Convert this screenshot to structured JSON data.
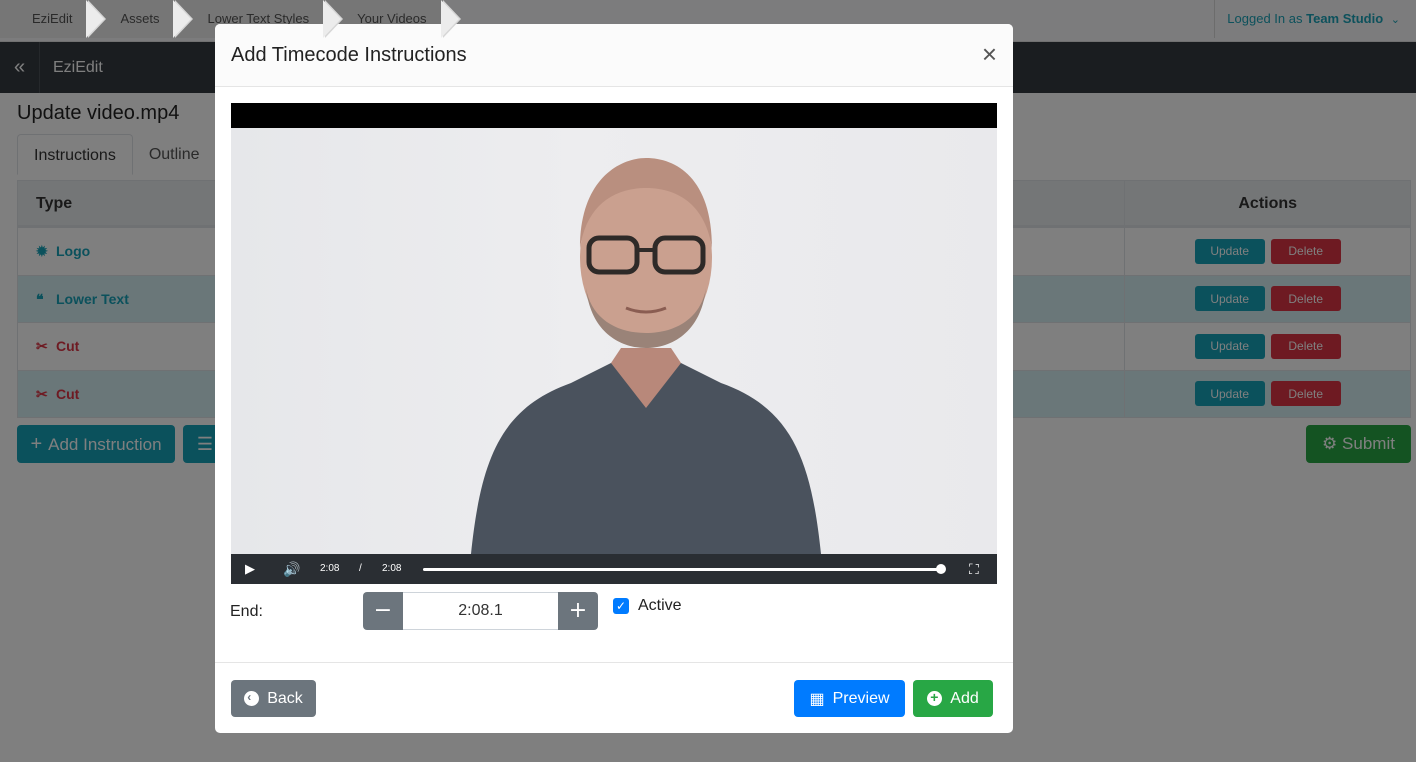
{
  "breadcrumbs": [
    "EziEdit",
    "Assets",
    "Lower Text Styles",
    "Your Videos"
  ],
  "user": {
    "prefix": "Logged In as",
    "name": "Team Studio"
  },
  "appbar": {
    "collapse_icon": "«",
    "brand": "EziEdit"
  },
  "page": {
    "title": "Update video.mp4",
    "tabs": [
      "Instructions",
      "Outline"
    ]
  },
  "table": {
    "headers": {
      "type": "Type",
      "actions": "Actions"
    },
    "rows": [
      {
        "type": "Logo",
        "icon": "gear-icon",
        "color": "#17a2b8"
      },
      {
        "type": "Lower Text",
        "icon": "quote-icon",
        "color": "#17a2b8"
      },
      {
        "type": "Cut",
        "icon": "scissors-icon",
        "color": "#dc3545"
      },
      {
        "type": "Cut",
        "icon": "scissors-icon",
        "color": "#dc3545"
      }
    ],
    "update_label": "Update",
    "delete_label": "Delete"
  },
  "actions": {
    "add_instruction": "Add Instruction",
    "submit": "Submit"
  },
  "modal": {
    "title": "Add Timecode Instructions",
    "close": "×",
    "video": {
      "current_time": "2:08",
      "separator": "/",
      "duration": "2:08",
      "progress": 1.0
    },
    "end_label": "End:",
    "end_value": "2:08.1",
    "minus": "−",
    "plus": "+",
    "active_label": "Active",
    "active_checked": true,
    "back": "Back",
    "preview": "Preview",
    "add": "Add"
  },
  "colors": {
    "info": "#17a2b8",
    "danger": "#dc3545",
    "success": "#28a745",
    "primary": "#007bff",
    "secondary": "#6c757d",
    "dark": "#343a40"
  }
}
